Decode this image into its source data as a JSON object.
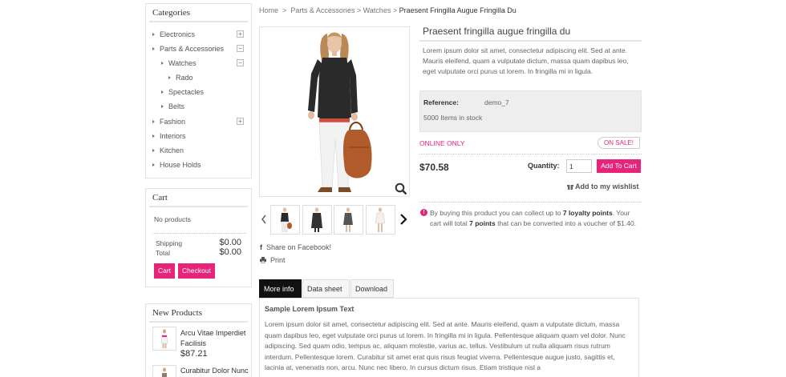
{
  "categories": {
    "title": "Categories",
    "items": [
      {
        "label": "Electronics",
        "toggle": "+"
      },
      {
        "label": "Parts & Accessories",
        "toggle": "−"
      },
      {
        "label": "Watches",
        "toggle": "−"
      },
      {
        "label": "Rado"
      },
      {
        "label": "Spectacles"
      },
      {
        "label": "Belts"
      },
      {
        "label": "Fashion",
        "toggle": "+"
      },
      {
        "label": "Interiors"
      },
      {
        "label": "Kitchen"
      },
      {
        "label": "House Holds"
      }
    ]
  },
  "cart": {
    "title": "Cart",
    "empty_text": "No products",
    "shipping_label": "Shipping",
    "shipping_value": "$0.00",
    "total_label": "Total",
    "total_value": "$0.00",
    "cart_button": "Cart",
    "checkout_button": "Checkout"
  },
  "new_products": {
    "title": "New Products",
    "items": [
      {
        "name": "Arcu Vitae Imperdiet Facilisis",
        "price": "$87.21"
      },
      {
        "name": "Curabitur Dolor Nunc",
        "price": ""
      }
    ]
  },
  "breadcrumb": {
    "home": "Home",
    "sep": ">",
    "level1": "Parts & Accessories",
    "level2": "Watches",
    "current": "Praesent Fringilla Augue Fringilla Du"
  },
  "product": {
    "title": "Praesent fringilla augue fringilla du",
    "description": "Lorem ipsum dolor sit amet, consectetur adipiscing elit. Sed at ante. Mauris eleifend, quam a vulputate dictum, massa quam dapibus leo, eget vulputate orci purus ut lorem. In fringilla mi in ligula.",
    "reference_label": "Reference:",
    "reference_value": "demo_7",
    "stock": "5000 Items in stock",
    "online_only": "ONLINE ONLY",
    "on_sale": "ON SALE!",
    "price": "$70.58",
    "quantity_label": "Quantity:",
    "quantity_value": "1",
    "add_to_cart": "Add To Cart",
    "wishlist": "Add to my wishlist",
    "loyalty_1": "By buying this product you can collect up to ",
    "loyalty_points": "7 loyalty points",
    "loyalty_2": ". Your cart will total ",
    "loyalty_points2": "7 points",
    "loyalty_3": " that can be converted into a voucher of $1.40.",
    "share": "Share on Facebook!",
    "print": "Print"
  },
  "tabs": {
    "items": [
      "More info",
      "Data sheet",
      "Download"
    ],
    "active": 0,
    "panel_title": "Sample Lorem Ipsum Text",
    "panel_text": "Lorem ipsum dolor sit amet, consectetur adipiscing elit. Sed at ante. Mauris eleifend, quam a vulputate dictum, massa quam dapibus leo, eget vulputate orci purus ut lorem. In fringilla mi in ligula. Pellentesque aliquam quam vel dolor. Nunc adipiscing. Sed quam odio, tempus ac, aliquam molestie, varius ac, tellus. Vestibulum ut nulla aliquam risus rutrum interdum. Pellentesque lorem. Curabitur sit amet erat quis risus feugiat viverra. Pellentesque augue justo, sagittis et, lacinia at, venenatis non, arcu. Nunc nec libero. In cursus dictum risus. Etiam tristique nisl a"
  },
  "colors": {
    "accent": "#e6257a",
    "online_only": "#e6257a"
  },
  "icons": [
    "plus-icon",
    "minus-icon",
    "zoom-icon",
    "prev-arrow-icon",
    "next-arrow-icon",
    "facebook-icon",
    "print-icon",
    "gift-icon",
    "info-icon"
  ]
}
